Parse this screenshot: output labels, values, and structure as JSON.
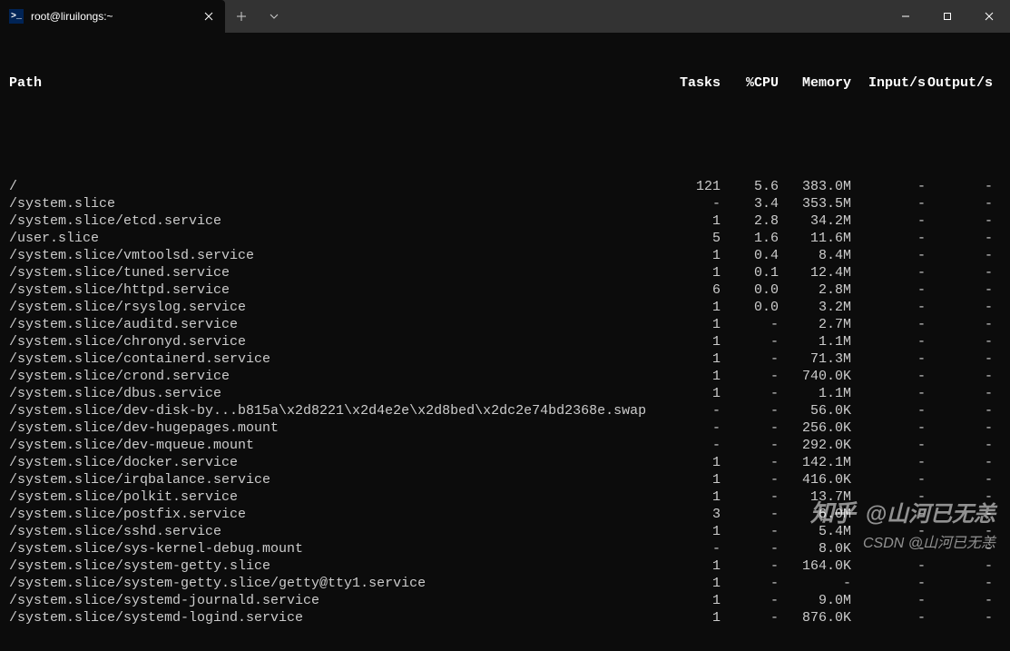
{
  "tab": {
    "title": "root@liruilongs:~",
    "icon_glyph": ">_"
  },
  "headers": {
    "path": "Path",
    "tasks": "Tasks",
    "cpu": "%CPU",
    "memory": "Memory",
    "input": "Input/s",
    "output": "Output/s"
  },
  "rows": [
    {
      "path": "/",
      "tasks": "121",
      "cpu": "5.6",
      "mem": "383.0M",
      "in": "-",
      "out": "-"
    },
    {
      "path": "/system.slice",
      "tasks": "-",
      "cpu": "3.4",
      "mem": "353.5M",
      "in": "-",
      "out": "-"
    },
    {
      "path": "/system.slice/etcd.service",
      "tasks": "1",
      "cpu": "2.8",
      "mem": "34.2M",
      "in": "-",
      "out": "-"
    },
    {
      "path": "/user.slice",
      "tasks": "5",
      "cpu": "1.6",
      "mem": "11.6M",
      "in": "-",
      "out": "-"
    },
    {
      "path": "/system.slice/vmtoolsd.service",
      "tasks": "1",
      "cpu": "0.4",
      "mem": "8.4M",
      "in": "-",
      "out": "-"
    },
    {
      "path": "/system.slice/tuned.service",
      "tasks": "1",
      "cpu": "0.1",
      "mem": "12.4M",
      "in": "-",
      "out": "-"
    },
    {
      "path": "/system.slice/httpd.service",
      "tasks": "6",
      "cpu": "0.0",
      "mem": "2.8M",
      "in": "-",
      "out": "-"
    },
    {
      "path": "/system.slice/rsyslog.service",
      "tasks": "1",
      "cpu": "0.0",
      "mem": "3.2M",
      "in": "-",
      "out": "-"
    },
    {
      "path": "/system.slice/auditd.service",
      "tasks": "1",
      "cpu": "-",
      "mem": "2.7M",
      "in": "-",
      "out": "-"
    },
    {
      "path": "/system.slice/chronyd.service",
      "tasks": "1",
      "cpu": "-",
      "mem": "1.1M",
      "in": "-",
      "out": "-"
    },
    {
      "path": "/system.slice/containerd.service",
      "tasks": "1",
      "cpu": "-",
      "mem": "71.3M",
      "in": "-",
      "out": "-"
    },
    {
      "path": "/system.slice/crond.service",
      "tasks": "1",
      "cpu": "-",
      "mem": "740.0K",
      "in": "-",
      "out": "-"
    },
    {
      "path": "/system.slice/dbus.service",
      "tasks": "1",
      "cpu": "-",
      "mem": "1.1M",
      "in": "-",
      "out": "-"
    },
    {
      "path": "/system.slice/dev-disk-by...b815a\\x2d8221\\x2d4e2e\\x2d8bed\\x2dc2e74bd2368e.swap",
      "tasks": "-",
      "cpu": "-",
      "mem": "56.0K",
      "in": "-",
      "out": "-"
    },
    {
      "path": "/system.slice/dev-hugepages.mount",
      "tasks": "-",
      "cpu": "-",
      "mem": "256.0K",
      "in": "-",
      "out": "-"
    },
    {
      "path": "/system.slice/dev-mqueue.mount",
      "tasks": "-",
      "cpu": "-",
      "mem": "292.0K",
      "in": "-",
      "out": "-"
    },
    {
      "path": "/system.slice/docker.service",
      "tasks": "1",
      "cpu": "-",
      "mem": "142.1M",
      "in": "-",
      "out": "-"
    },
    {
      "path": "/system.slice/irqbalance.service",
      "tasks": "1",
      "cpu": "-",
      "mem": "416.0K",
      "in": "-",
      "out": "-"
    },
    {
      "path": "/system.slice/polkit.service",
      "tasks": "1",
      "cpu": "-",
      "mem": "13.7M",
      "in": "-",
      "out": "-"
    },
    {
      "path": "/system.slice/postfix.service",
      "tasks": "3",
      "cpu": "-",
      "mem": "6.0M",
      "in": "-",
      "out": "-"
    },
    {
      "path": "/system.slice/sshd.service",
      "tasks": "1",
      "cpu": "-",
      "mem": "5.4M",
      "in": "-",
      "out": "-"
    },
    {
      "path": "/system.slice/sys-kernel-debug.mount",
      "tasks": "-",
      "cpu": "-",
      "mem": "8.0K",
      "in": "-",
      "out": "-"
    },
    {
      "path": "/system.slice/system-getty.slice",
      "tasks": "1",
      "cpu": "-",
      "mem": "164.0K",
      "in": "-",
      "out": "-"
    },
    {
      "path": "/system.slice/system-getty.slice/getty@tty1.service",
      "tasks": "1",
      "cpu": "-",
      "mem": "-",
      "in": "-",
      "out": "-"
    },
    {
      "path": "/system.slice/systemd-journald.service",
      "tasks": "1",
      "cpu": "-",
      "mem": "9.0M",
      "in": "-",
      "out": "-"
    },
    {
      "path": "/system.slice/systemd-logind.service",
      "tasks": "1",
      "cpu": "-",
      "mem": "876.0K",
      "in": "-",
      "out": "-"
    }
  ],
  "watermarks": {
    "line1_prefix": "知乎",
    "line1": " @山河已无恙",
    "line2": "CSDN @山河已无恙"
  }
}
